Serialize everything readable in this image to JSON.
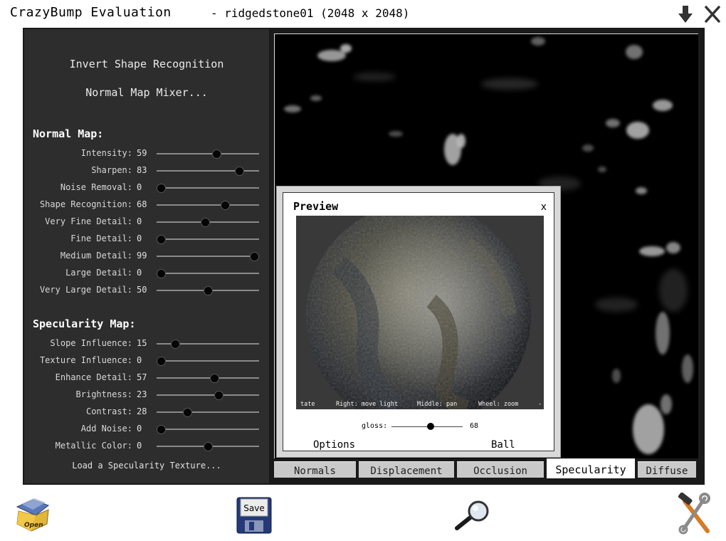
{
  "window": {
    "title": "CrazyBump Evaluation",
    "subtitle": "- ridgedstone01 (2048 x 2048)"
  },
  "left_panel": {
    "invert_shape_label": "Invert Shape Recognition",
    "mixer_label": "Normal Map Mixer...",
    "normal_section": "Normal Map:",
    "normal_sliders": [
      {
        "label": "Intensity:",
        "value": "59",
        "level": 59
      },
      {
        "label": "Sharpen:",
        "value": "83",
        "level": 83
      },
      {
        "label": "Noise Removal:",
        "value": "0",
        "level": 0
      },
      {
        "label": "Shape Recognition:",
        "value": "68",
        "level": 68
      },
      {
        "label": "Very Fine Detail:",
        "value": "0",
        "level": 47
      },
      {
        "label": "Fine Detail:",
        "value": "0",
        "level": 0
      },
      {
        "label": "Medium Detail:",
        "value": "99",
        "level": 99
      },
      {
        "label": "Large Detail:",
        "value": "0",
        "level": 0
      },
      {
        "label": "Very Large Detail:",
        "value": "50",
        "level": 50
      }
    ],
    "spec_section": "Specularity Map:",
    "spec_sliders": [
      {
        "label": "Slope Influence:",
        "value": "15",
        "level": 15
      },
      {
        "label": "Texture Influence:",
        "value": "0",
        "level": 0
      },
      {
        "label": "Enhance Detail:",
        "value": "57",
        "level": 57
      },
      {
        "label": "Brightness:",
        "value": "23",
        "level": 61
      },
      {
        "label": "Contrast:",
        "value": "28",
        "level": 28
      },
      {
        "label": "Add Noise:",
        "value": "0",
        "level": 0
      },
      {
        "label": "Metallic Color:",
        "value": "0",
        "level": 50
      }
    ],
    "load_spec_label": "Load a Specularity Texture..."
  },
  "preview": {
    "title": "Preview",
    "close": "x",
    "hint_left": "tate",
    "hint_right": "Right: move light",
    "hint_middle": "Middle: pan",
    "hint_wheel": "Wheel: zoom",
    "hint_end": "-",
    "gloss_label": "gloss:",
    "gloss_value": "68",
    "gloss_level": 55,
    "options_label": "Options",
    "ball_label": "Ball"
  },
  "tabs": [
    {
      "label": "Normals",
      "active": false
    },
    {
      "label": "Displacement",
      "active": false
    },
    {
      "label": "Occlusion",
      "active": false
    },
    {
      "label": "Specularity",
      "active": true
    },
    {
      "label": "Diffuse",
      "active": false
    }
  ],
  "toolbar": {
    "open_label": "Open",
    "save_label": "Save"
  },
  "icons": [
    "download-arrow-icon",
    "close-icon",
    "open-folder-icon",
    "save-floppy-icon",
    "magnifier-icon",
    "tools-icon"
  ]
}
